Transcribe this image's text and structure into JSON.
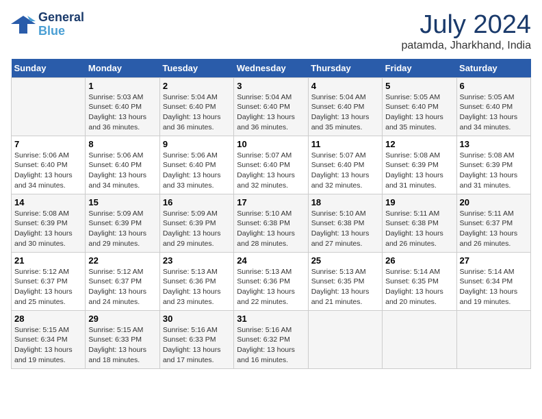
{
  "logo": {
    "text_line1": "General",
    "text_line2": "Blue"
  },
  "header": {
    "month": "July 2024",
    "location": "patamda, Jharkhand, India"
  },
  "weekdays": [
    "Sunday",
    "Monday",
    "Tuesday",
    "Wednesday",
    "Thursday",
    "Friday",
    "Saturday"
  ],
  "weeks": [
    [
      {
        "day": "",
        "info": ""
      },
      {
        "day": "1",
        "info": "Sunrise: 5:03 AM\nSunset: 6:40 PM\nDaylight: 13 hours\nand 36 minutes."
      },
      {
        "day": "2",
        "info": "Sunrise: 5:04 AM\nSunset: 6:40 PM\nDaylight: 13 hours\nand 36 minutes."
      },
      {
        "day": "3",
        "info": "Sunrise: 5:04 AM\nSunset: 6:40 PM\nDaylight: 13 hours\nand 36 minutes."
      },
      {
        "day": "4",
        "info": "Sunrise: 5:04 AM\nSunset: 6:40 PM\nDaylight: 13 hours\nand 35 minutes."
      },
      {
        "day": "5",
        "info": "Sunrise: 5:05 AM\nSunset: 6:40 PM\nDaylight: 13 hours\nand 35 minutes."
      },
      {
        "day": "6",
        "info": "Sunrise: 5:05 AM\nSunset: 6:40 PM\nDaylight: 13 hours\nand 34 minutes."
      }
    ],
    [
      {
        "day": "7",
        "info": "Sunrise: 5:06 AM\nSunset: 6:40 PM\nDaylight: 13 hours\nand 34 minutes."
      },
      {
        "day": "8",
        "info": "Sunrise: 5:06 AM\nSunset: 6:40 PM\nDaylight: 13 hours\nand 34 minutes."
      },
      {
        "day": "9",
        "info": "Sunrise: 5:06 AM\nSunset: 6:40 PM\nDaylight: 13 hours\nand 33 minutes."
      },
      {
        "day": "10",
        "info": "Sunrise: 5:07 AM\nSunset: 6:40 PM\nDaylight: 13 hours\nand 32 minutes."
      },
      {
        "day": "11",
        "info": "Sunrise: 5:07 AM\nSunset: 6:40 PM\nDaylight: 13 hours\nand 32 minutes."
      },
      {
        "day": "12",
        "info": "Sunrise: 5:08 AM\nSunset: 6:39 PM\nDaylight: 13 hours\nand 31 minutes."
      },
      {
        "day": "13",
        "info": "Sunrise: 5:08 AM\nSunset: 6:39 PM\nDaylight: 13 hours\nand 31 minutes."
      }
    ],
    [
      {
        "day": "14",
        "info": "Sunrise: 5:08 AM\nSunset: 6:39 PM\nDaylight: 13 hours\nand 30 minutes."
      },
      {
        "day": "15",
        "info": "Sunrise: 5:09 AM\nSunset: 6:39 PM\nDaylight: 13 hours\nand 29 minutes."
      },
      {
        "day": "16",
        "info": "Sunrise: 5:09 AM\nSunset: 6:39 PM\nDaylight: 13 hours\nand 29 minutes."
      },
      {
        "day": "17",
        "info": "Sunrise: 5:10 AM\nSunset: 6:38 PM\nDaylight: 13 hours\nand 28 minutes."
      },
      {
        "day": "18",
        "info": "Sunrise: 5:10 AM\nSunset: 6:38 PM\nDaylight: 13 hours\nand 27 minutes."
      },
      {
        "day": "19",
        "info": "Sunrise: 5:11 AM\nSunset: 6:38 PM\nDaylight: 13 hours\nand 26 minutes."
      },
      {
        "day": "20",
        "info": "Sunrise: 5:11 AM\nSunset: 6:37 PM\nDaylight: 13 hours\nand 26 minutes."
      }
    ],
    [
      {
        "day": "21",
        "info": "Sunrise: 5:12 AM\nSunset: 6:37 PM\nDaylight: 13 hours\nand 25 minutes."
      },
      {
        "day": "22",
        "info": "Sunrise: 5:12 AM\nSunset: 6:37 PM\nDaylight: 13 hours\nand 24 minutes."
      },
      {
        "day": "23",
        "info": "Sunrise: 5:13 AM\nSunset: 6:36 PM\nDaylight: 13 hours\nand 23 minutes."
      },
      {
        "day": "24",
        "info": "Sunrise: 5:13 AM\nSunset: 6:36 PM\nDaylight: 13 hours\nand 22 minutes."
      },
      {
        "day": "25",
        "info": "Sunrise: 5:13 AM\nSunset: 6:35 PM\nDaylight: 13 hours\nand 21 minutes."
      },
      {
        "day": "26",
        "info": "Sunrise: 5:14 AM\nSunset: 6:35 PM\nDaylight: 13 hours\nand 20 minutes."
      },
      {
        "day": "27",
        "info": "Sunrise: 5:14 AM\nSunset: 6:34 PM\nDaylight: 13 hours\nand 19 minutes."
      }
    ],
    [
      {
        "day": "28",
        "info": "Sunrise: 5:15 AM\nSunset: 6:34 PM\nDaylight: 13 hours\nand 19 minutes."
      },
      {
        "day": "29",
        "info": "Sunrise: 5:15 AM\nSunset: 6:33 PM\nDaylight: 13 hours\nand 18 minutes."
      },
      {
        "day": "30",
        "info": "Sunrise: 5:16 AM\nSunset: 6:33 PM\nDaylight: 13 hours\nand 17 minutes."
      },
      {
        "day": "31",
        "info": "Sunrise: 5:16 AM\nSunset: 6:32 PM\nDaylight: 13 hours\nand 16 minutes."
      },
      {
        "day": "",
        "info": ""
      },
      {
        "day": "",
        "info": ""
      },
      {
        "day": "",
        "info": ""
      }
    ]
  ]
}
